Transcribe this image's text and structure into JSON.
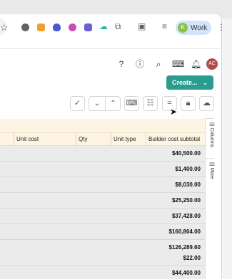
{
  "browser": {
    "profile_label": "Work",
    "profile_initial": "K",
    "menu_icon": "kebab-icon"
  },
  "header": {
    "user_initials": "AC",
    "create_label": "Create...",
    "brand_color": "#2a9d8f"
  },
  "grid": {
    "columns": [
      "Unit cost",
      "Qty",
      "Unit type",
      "Builder cost subtotal"
    ],
    "rows": [
      {
        "subtotal": "$40,500.00"
      },
      {
        "subtotal": "$1,400.00"
      },
      {
        "subtotal": "$8,030.00"
      },
      {
        "subtotal": "$25,250.00"
      },
      {
        "subtotal": "$37,428.00"
      },
      {
        "subtotal": "$160,804.00"
      },
      {
        "subtotal": "$126,289.60"
      },
      {
        "subtotal": "$22.00"
      },
      {
        "subtotal": "$44,400.00"
      }
    ]
  },
  "side_tabs": {
    "columns": "Columns",
    "more": "More"
  }
}
